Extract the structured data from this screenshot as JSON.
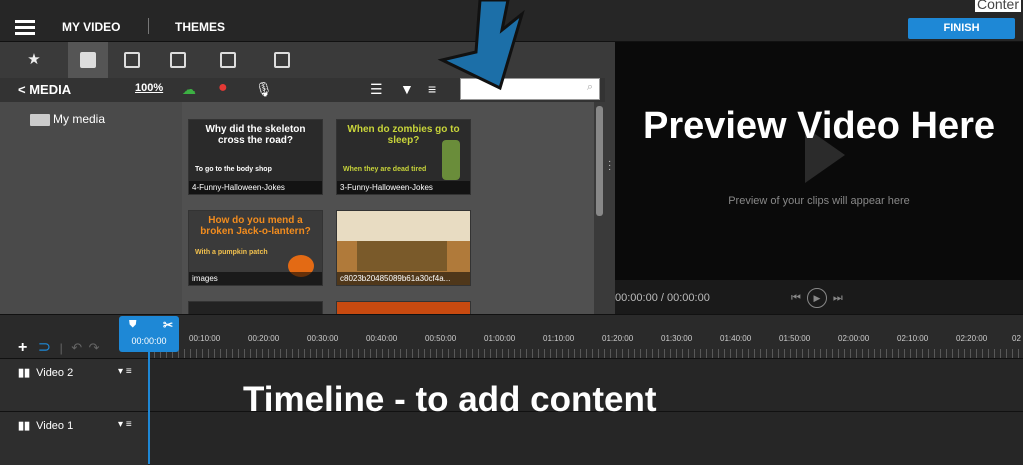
{
  "topbar": {
    "app_title": "MY VIDEO",
    "themes": "THEMES",
    "finish": "FINISH",
    "corner_text": "Conter"
  },
  "library": {
    "tabs": [
      "star-icon",
      "folder-star-icon",
      "image-icon",
      "image-add-icon",
      "image-edit-icon",
      "images-icon"
    ],
    "back_label": "< MEDIA",
    "zoom_label": "100%",
    "search_placeholder": "",
    "folder_label": "My media",
    "thumbnails": [
      {
        "title": "Why did the skeleton cross the road?",
        "answer": "To go to the body shop",
        "caption": "4-Funny-Halloween-Jokes"
      },
      {
        "title": "When do zombies go to sleep?",
        "answer": "When they are dead tired",
        "caption": "3-Funny-Halloween-Jokes"
      },
      {
        "title": "How do you mend a broken Jack-o-lantern?",
        "answer": "With a pumpkin patch",
        "caption": "images"
      },
      {
        "title": "",
        "answer": "",
        "caption": "c8023b20485089b61a30cf4a..."
      }
    ]
  },
  "preview": {
    "overlay_text": "Preview Video Here",
    "message": "Preview of your clips will appear here",
    "time": "00:00:00 / 00:00:00"
  },
  "timeline": {
    "playhead_time": "00:00:00",
    "ticks": [
      "00:10:00",
      "00:20:00",
      "00:30:00",
      "00:40:00",
      "00:50:00",
      "01:00:00",
      "01:10:00",
      "01:20:00",
      "01:30:00",
      "01:40:00",
      "01:50:00",
      "02:00:00",
      "02:10:00",
      "02:20:00",
      "02"
    ],
    "tracks": [
      {
        "name": "Video 2"
      },
      {
        "name": "Video 1"
      }
    ],
    "overlay_text": "Timeline - to add content"
  },
  "colors": {
    "accent": "#1e88d6",
    "arrow": "#1c6fa8"
  }
}
